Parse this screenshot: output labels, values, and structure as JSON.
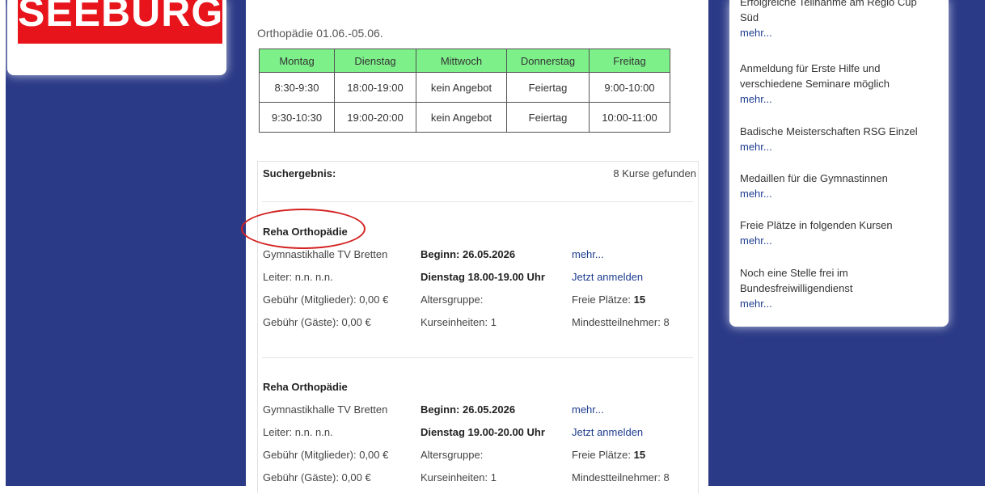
{
  "logo": {
    "text": "SEEBURGER"
  },
  "schedule": {
    "title": "Orthopädie 01.06.-05.06.",
    "headers": [
      "Montag",
      "Dienstag",
      "Mittwoch",
      "Donnerstag",
      "Freitag"
    ],
    "rows": [
      [
        "8:30-9:30",
        "18:00-19:00",
        "kein Angebot",
        "Feiertag",
        "9:00-10:00"
      ],
      [
        "9:30-10:30",
        "19:00-20:00",
        "kein Angebot",
        "Feiertag",
        "10:00-11:00"
      ]
    ]
  },
  "results": {
    "label": "Suchergebnis:",
    "count": "8 Kurse gefunden",
    "courses": [
      {
        "title": "Reha Orthopädie",
        "location": "Gymnastikhalle TV Bretten",
        "start": "Beginn: 26.05.2026",
        "more": "mehr...",
        "leader": "Leiter: n.n. n.n.",
        "time": "Dienstag 18.00-19.00 Uhr",
        "register": "Jetzt anmelden",
        "fee_members": "Gebühr (Mitglieder): 0,00 €",
        "age_group": "Altersgruppe:",
        "free_label": "Freie Plätze: ",
        "free_value": "15",
        "fee_guests": "Gebühr (Gäste): 0,00 €",
        "units": "Kurseinheiten: 1",
        "min_participants": "Mindestteilnehmer: 8"
      },
      {
        "title": "Reha Orthopädie",
        "location": "Gymnastikhalle TV Bretten",
        "start": "Beginn: 26.05.2026",
        "more": "mehr...",
        "leader": "Leiter: n.n. n.n.",
        "time": "Dienstag 19.00-20.00 Uhr",
        "register": "Jetzt anmelden",
        "fee_members": "Gebühr (Mitglieder): 0,00 €",
        "age_group": "Altersgruppe:",
        "free_label": "Freie Plätze: ",
        "free_value": "15",
        "fee_guests": "Gebühr (Gäste): 0,00 €",
        "units": "Kurseinheiten: 1",
        "min_participants": "Mindestteilnehmer: 8"
      }
    ]
  },
  "news": [
    {
      "lines": [
        "Erfolgreiche Teilnahme am Regio Cup",
        "Süd"
      ],
      "more": "mehr..."
    },
    {
      "lines": [
        "Anmeldung für Erste Hilfe und",
        "verschiedene Seminare möglich"
      ],
      "more": "mehr..."
    },
    {
      "lines": [
        "Badische Meisterschaften RSG Einzel"
      ],
      "more": "mehr..."
    },
    {
      "lines": [
        "Medaillen für die Gymnastinnen"
      ],
      "more": "mehr..."
    },
    {
      "lines": [
        "Freie Plätze in folgenden Kursen"
      ],
      "more": "mehr..."
    },
    {
      "lines": [
        "Noch eine Stelle frei im",
        "Bundesfreiwilligendienst"
      ],
      "more": "mehr..."
    }
  ],
  "colors": {
    "page_bg": "#2b3a87",
    "logo_red": "#e8141b",
    "table_header": "#7ef08a",
    "link": "#1d3c8f",
    "highlight": "#d42121"
  }
}
